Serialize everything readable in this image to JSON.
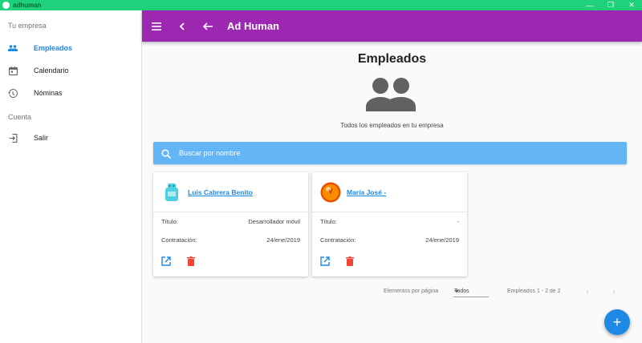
{
  "window": {
    "title": "adhuman"
  },
  "sidebar": {
    "section_main": "Tu empresa",
    "section_account": "Cuenta",
    "items": [
      {
        "label": "Empleados",
        "icon": "people-icon",
        "active": true
      },
      {
        "label": "Calendario",
        "icon": "calendar-icon",
        "active": false
      },
      {
        "label": "Nóminas",
        "icon": "history-icon",
        "active": false
      }
    ],
    "account_items": [
      {
        "label": "Salir",
        "icon": "exit-icon"
      }
    ]
  },
  "appbar": {
    "title": "Ad Human"
  },
  "main": {
    "title": "Empleados",
    "subtitle": "Todos los empleados en tu empresa",
    "search_placeholder": "Buscar por nombre"
  },
  "cards": [
    {
      "name": "Luis Cabrera Benito",
      "title_label": "Título:",
      "title_value": "Desarrollador móvil",
      "hire_label": "Contratación:",
      "hire_value": "24/ene/2019"
    },
    {
      "name": "María José -",
      "title_label": "Título:",
      "title_value": "-",
      "hire_label": "Contratación:",
      "hire_value": "24/ene/2019"
    }
  ],
  "pager": {
    "items_per_page_label": "Elementos por página",
    "selected": "Todos",
    "range": "Empleados 1 - 2 de 2"
  },
  "colors": {
    "appbar": "#9c27b0",
    "accent": "#1e88e5",
    "search": "#64b5f6",
    "titlebar": "#1fd17a",
    "delete": "#f44336"
  }
}
